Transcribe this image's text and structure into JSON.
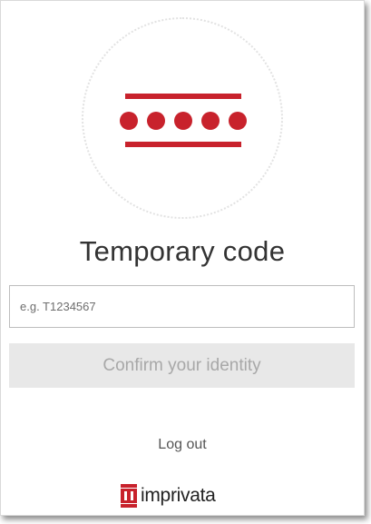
{
  "login": {
    "title": "Temporary code",
    "code_placeholder": "e.g. T1234567",
    "code_value": "",
    "confirm_label": "Confirm your identity",
    "logout_label": "Log out"
  },
  "brand": {
    "name": "imprivata"
  },
  "icons": {
    "emblem": "temporary-code-icon",
    "brand_mark": "imprivata-logo-icon"
  },
  "colors": {
    "accent": "#c8222c",
    "button_disabled_bg": "#e8e8e8",
    "button_disabled_text": "#a8a8a8"
  }
}
